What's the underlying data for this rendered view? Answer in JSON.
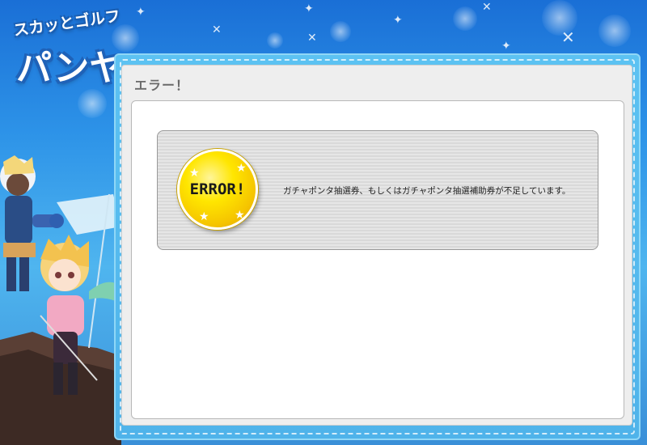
{
  "logo": {
    "top_text": "スカッとゴルフ",
    "main_text": "パンヤ"
  },
  "panel": {
    "title": "エラー！"
  },
  "error": {
    "badge_text": "ERROR!",
    "message": "ガチャポンタ抽選券、もしくはガチャポンタ抽選補助券が不足しています。"
  },
  "colors": {
    "background": "#2d93e8",
    "frame": "#5cc2f2",
    "panel": "#eeeeee",
    "badge": "#ffe600"
  },
  "icons": {
    "badge_stars": "star-icon",
    "sparkles": "sparkle-icon"
  }
}
